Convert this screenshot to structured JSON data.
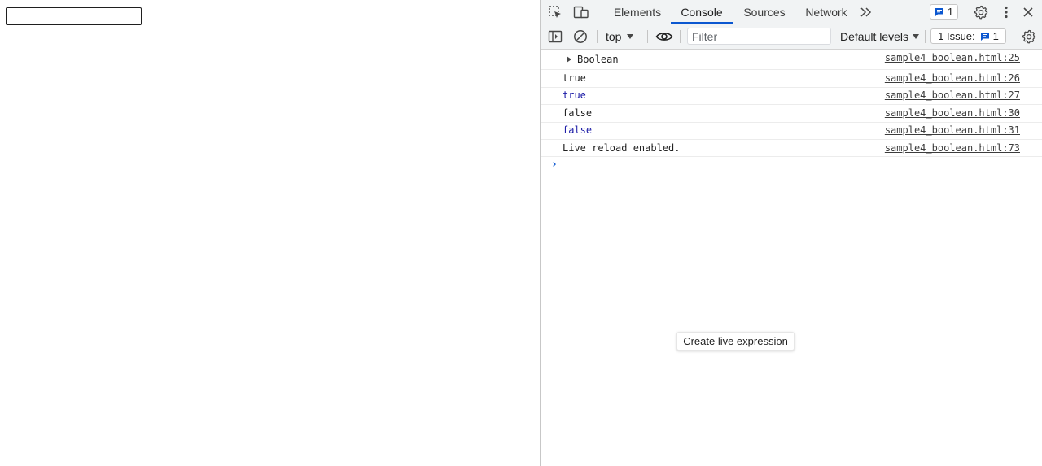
{
  "page": {
    "input_value": ""
  },
  "devtools": {
    "tabs": [
      {
        "label": "Elements"
      },
      {
        "label": "Console"
      },
      {
        "label": "Sources"
      },
      {
        "label": "Network"
      }
    ],
    "active_tab": "Console",
    "messages_badge_count": "1",
    "context_selector": "top",
    "filter_placeholder": "Filter",
    "filter_value": "",
    "levels_label": "Default levels",
    "issues_label": "1 Issue:",
    "issues_count": "1",
    "accent_color": "#0b57d0",
    "console_messages": [
      {
        "text": "Boolean",
        "source": "sample4_boolean.html:25",
        "expandable": true
      },
      {
        "text": "true",
        "source": "sample4_boolean.html:26"
      },
      {
        "text": "true",
        "source": "sample4_boolean.html:27"
      },
      {
        "text": "false",
        "source": "sample4_boolean.html:30"
      },
      {
        "text": "false",
        "source": "sample4_boolean.html:31"
      },
      {
        "text": "Live reload enabled.",
        "source": "sample4_boolean.html:73"
      }
    ],
    "prompt_symbol": "›",
    "live_expression_label": "Create live expression"
  }
}
